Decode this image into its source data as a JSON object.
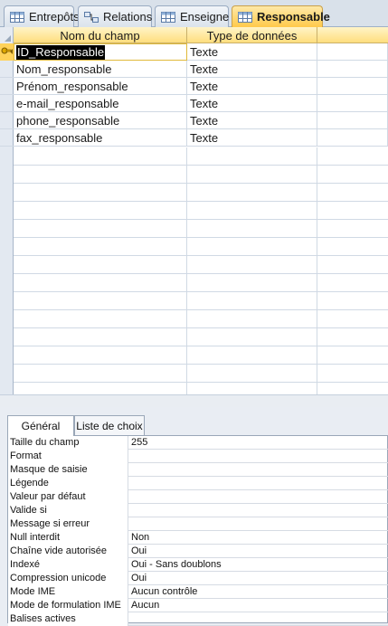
{
  "tabs": [
    {
      "label": "Entrepôts",
      "icon": "table-icon",
      "active": false
    },
    {
      "label": "Relations",
      "icon": "relationships-icon",
      "active": false
    },
    {
      "label": "Enseigne",
      "icon": "table-icon",
      "active": false
    },
    {
      "label": "Responsable",
      "icon": "table-icon",
      "active": true
    }
  ],
  "design_grid": {
    "columns": [
      "Nom du champ",
      "Type de données"
    ],
    "rows": [
      {
        "name": "ID_Responsable",
        "type": "Texte",
        "primary_key": true,
        "selected": true
      },
      {
        "name": "Nom_responsable",
        "type": "Texte"
      },
      {
        "name": "Prénom_responsable",
        "type": "Texte"
      },
      {
        "name": "e-mail_responsable",
        "type": "Texte"
      },
      {
        "name": "phone_responsable",
        "type": "Texte"
      },
      {
        "name": "fax_responsable",
        "type": "Texte"
      }
    ]
  },
  "properties": {
    "tabs": [
      "Général",
      "Liste de choix"
    ],
    "rows": [
      {
        "label": "Taille du champ",
        "value": "255"
      },
      {
        "label": "Format",
        "value": ""
      },
      {
        "label": "Masque de saisie",
        "value": ""
      },
      {
        "label": "Légende",
        "value": ""
      },
      {
        "label": "Valeur par défaut",
        "value": ""
      },
      {
        "label": "Valide si",
        "value": ""
      },
      {
        "label": "Message si erreur",
        "value": ""
      },
      {
        "label": "Null interdit",
        "value": "Non"
      },
      {
        "label": "Chaîne vide autorisée",
        "value": "Oui"
      },
      {
        "label": "Indexé",
        "value": "Oui - Sans doublons"
      },
      {
        "label": "Compression unicode",
        "value": "Oui"
      },
      {
        "label": "Mode IME",
        "value": "Aucun contrôle"
      },
      {
        "label": "Mode de formulation IME",
        "value": "Aucun"
      },
      {
        "label": "Balises actives",
        "value": ""
      }
    ]
  },
  "colors": {
    "active_tab": "#ffc94a",
    "grid_header": "#ffde7e",
    "selection": "#000000"
  }
}
